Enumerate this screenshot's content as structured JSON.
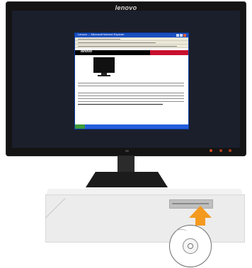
{
  "monitor": {
    "brand": "lenovo",
    "screen_window": {
      "title": "Lenovo ... Microsoft Internet Explorer",
      "logo": "lenovo"
    }
  },
  "colors": {
    "arrow": "#f39a1f",
    "monitor_bezel": "#141414",
    "taskbar": "#245edb"
  },
  "icons": [
    "lenovo-logo",
    "cd-disc-icon",
    "insert-arrow-icon",
    "optical-drive"
  ]
}
